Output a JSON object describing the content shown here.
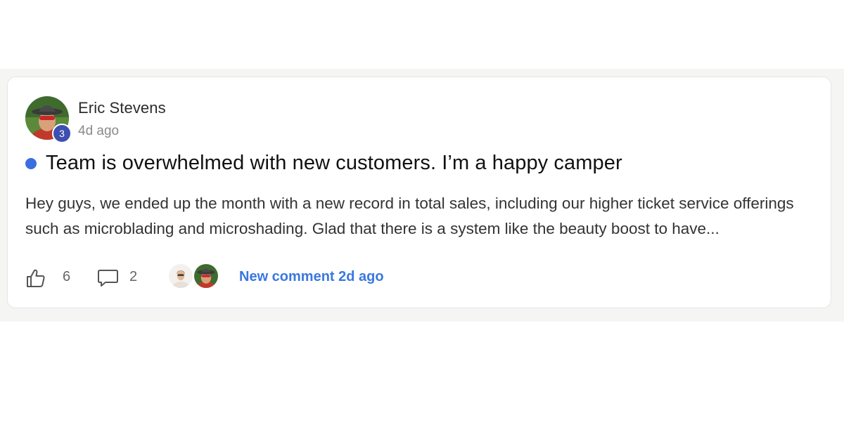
{
  "post": {
    "author": {
      "name": "Eric Stevens",
      "level": "3",
      "avatar_icon": "avatar-photo-man-with-hat-icon"
    },
    "timestamp": "4d ago",
    "title": "Team is overwhelmed with new customers. I’m a happy camper",
    "body": "Hey guys, we ended up the month with a new record in total sales, including our higher ticket service offerings such as microblading and microshading. Glad that there is a system like the beauty boost to have...",
    "unread": true,
    "likes": "6",
    "comments": "2",
    "recent_commenters": [
      {
        "icon": "avatar-photo-woman-icon"
      },
      {
        "icon": "avatar-photo-man-with-hat-icon"
      }
    ],
    "new_comment_label": "New comment 2d ago"
  },
  "colors": {
    "accent": "#3a78e0",
    "unread_dot": "#3b6fe0",
    "level_badge": "#3d4fb0",
    "page_band": "#f5f5f4"
  }
}
